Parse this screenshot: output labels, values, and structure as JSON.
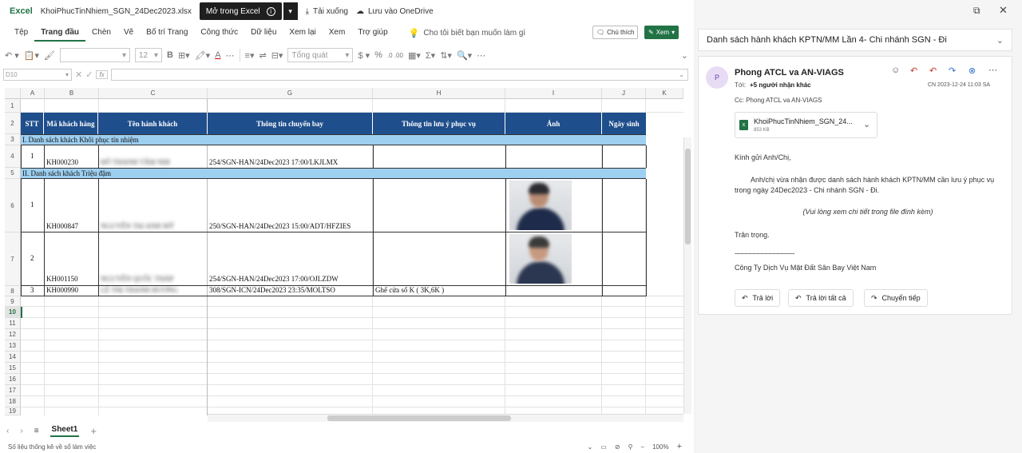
{
  "topbar": {
    "app": "Excel",
    "filename": "KhoiPhucTinNhiem_SGN_24Dec2023.xlsx",
    "open_label": "Mở trong Excel",
    "download_label": "Tải xuống",
    "onedrive_label": "Lưu vào OneDrive"
  },
  "tabs": [
    "Tệp",
    "Trang đầu",
    "Chèn",
    "Vẽ",
    "Bố trí Trang",
    "Công thức",
    "Dữ liệu",
    "Xem lại",
    "Xem",
    "Trợ giúp"
  ],
  "tellme": "Cho tôi biết bạn muốn làm gì",
  "comment_label": "Chú thích",
  "view_label": "Xem",
  "toolbar": {
    "font_size": "12",
    "number_format": "Tổng quát"
  },
  "namebox": "D10",
  "columns": [
    "A",
    "B",
    "C",
    "G",
    "H",
    "I",
    "J",
    "K"
  ],
  "rows": [
    "1",
    "2",
    "3",
    "4",
    "5",
    "6",
    "7",
    "8",
    "9",
    "10",
    "11",
    "12",
    "13",
    "14",
    "15",
    "16",
    "17",
    "18",
    "19"
  ],
  "table": {
    "headers": [
      "STT",
      "Mã khách hàng",
      "Tên hành khách",
      "Thông tin chuyến bay",
      "Thông tin lưu ý phục vụ",
      "Ảnh",
      "Ngày sinh"
    ],
    "section1": "I. Danh sách khách Khôi phục tín nhiệm",
    "section2": "II. Danh sách khách Triệu đậm",
    "rows": [
      {
        "stt": "1",
        "code": "KH000230",
        "name": "ĐỖ THANH TÂM NHI",
        "flight": "254/SGN-HAN/24Dec2023 17:00/LKJLMX",
        "note": ""
      },
      {
        "stt": "1",
        "code": "KH000847",
        "name": "NGUYỄN TAI ANH MỸ",
        "flight": "250/SGN-HAN/24Dec2023 15:00/ADT/HFZIES",
        "note": ""
      },
      {
        "stt": "2",
        "code": "KH001150",
        "name": "NGUYỄN QUỐC THÁP",
        "flight": "254/SGN-HAN/24Dec2023 17:00/OJLZDW",
        "note": ""
      },
      {
        "stt": "3",
        "code": "KH000990",
        "name": "LÊ THỊ THANH HƯƠNG",
        "flight": "308/SGN-ICN/24Dec2023 23:35/MOLTSO",
        "note": "Ghế cửa sổ K ( 3K,6K )"
      }
    ]
  },
  "sheet_tab": "Sheet1",
  "status_text": "Số liệu thống kê về sổ làm việc",
  "zoom": "100%",
  "email": {
    "subject": "Danh sách hành khách KPTN/MM Lần 4- Chi nhánh SGN - Đi",
    "avatar": "P",
    "sender": "Phong ATCL va AN-VIAGS",
    "to_prefix": "Tới:",
    "to_value": "+5 người nhận khác",
    "date": "CN 2023-12-24 11:03 SA",
    "cc": "Cc: Phong ATCL va AN-VIAGS",
    "attachment_name": "KhoiPhucTinNhiem_SGN_24...",
    "attachment_size": "853 KB",
    "greeting": "Kính gửi Anh/Chị,",
    "body": "Anh/chị vừa nhận được danh sách hành khách KPTN/MM cần lưu ý phục vụ trong ngày 24Dec2023 - Chi nhánh SGN - Đi.",
    "note": "(Vui lòng xem chi tiết trong file đính kèm)",
    "closing": "Trân trọng.",
    "sig_line": "------------------------------",
    "company": "Công Ty Dịch Vụ Mặt Đất Sân Bay Việt Nam",
    "reply": "Trả lời",
    "reply_all": "Trả lời tất cả",
    "forward": "Chuyển tiếp"
  }
}
